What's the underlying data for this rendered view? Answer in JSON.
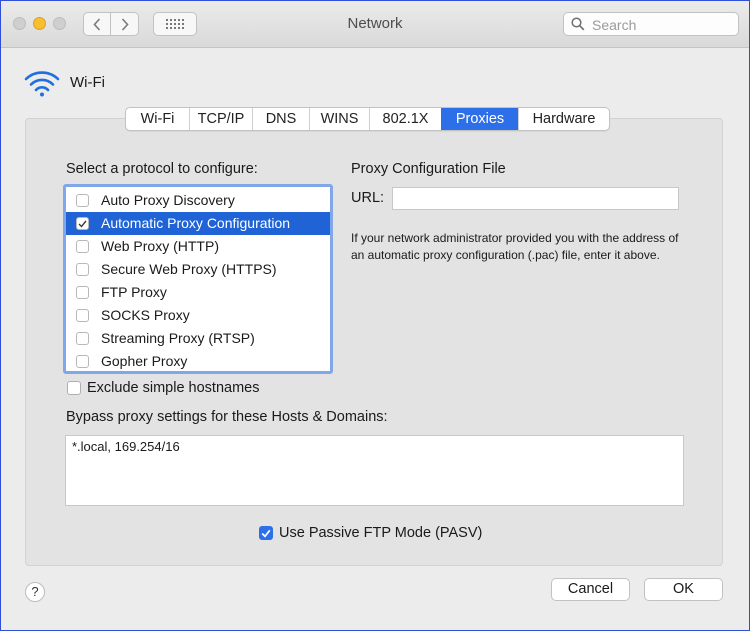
{
  "window": {
    "title": "Network"
  },
  "toolbar": {
    "search_placeholder": "Search"
  },
  "header": {
    "interface_name": "Wi-Fi"
  },
  "tabs": [
    {
      "label": "Wi-Fi"
    },
    {
      "label": "TCP/IP"
    },
    {
      "label": "DNS"
    },
    {
      "label": "WINS"
    },
    {
      "label": "802.1X"
    },
    {
      "label": "Proxies",
      "active": true
    },
    {
      "label": "Hardware"
    }
  ],
  "protocol_section": {
    "heading": "Select a protocol to configure:",
    "items": [
      {
        "label": "Auto Proxy Discovery",
        "checked": false,
        "selected": false
      },
      {
        "label": "Automatic Proxy Configuration",
        "checked": true,
        "selected": true
      },
      {
        "label": "Web Proxy (HTTP)",
        "checked": false,
        "selected": false
      },
      {
        "label": "Secure Web Proxy (HTTPS)",
        "checked": false,
        "selected": false
      },
      {
        "label": "FTP Proxy",
        "checked": false,
        "selected": false
      },
      {
        "label": "SOCKS Proxy",
        "checked": false,
        "selected": false
      },
      {
        "label": "Streaming Proxy (RTSP)",
        "checked": false,
        "selected": false
      },
      {
        "label": "Gopher Proxy",
        "checked": false,
        "selected": false
      }
    ]
  },
  "config_file": {
    "heading": "Proxy Configuration File",
    "url_label": "URL:",
    "url_value": "",
    "help_text": "If your network administrator provided you with the address of an automatic proxy configuration (.pac) file, enter it above."
  },
  "exclude_simple": {
    "label": "Exclude simple hostnames",
    "checked": false
  },
  "bypass": {
    "label": "Bypass proxy settings for these Hosts & Domains:",
    "value": "*.local, 169.254/16"
  },
  "passive_ftp": {
    "label": "Use Passive FTP Mode (PASV)",
    "checked": true
  },
  "footer": {
    "help_label": "?",
    "cancel_label": "Cancel",
    "ok_label": "OK"
  },
  "colors": {
    "accent": "#2d6fe8",
    "selection": "#1f63d6",
    "focus_ring": "#7fa7ea"
  }
}
